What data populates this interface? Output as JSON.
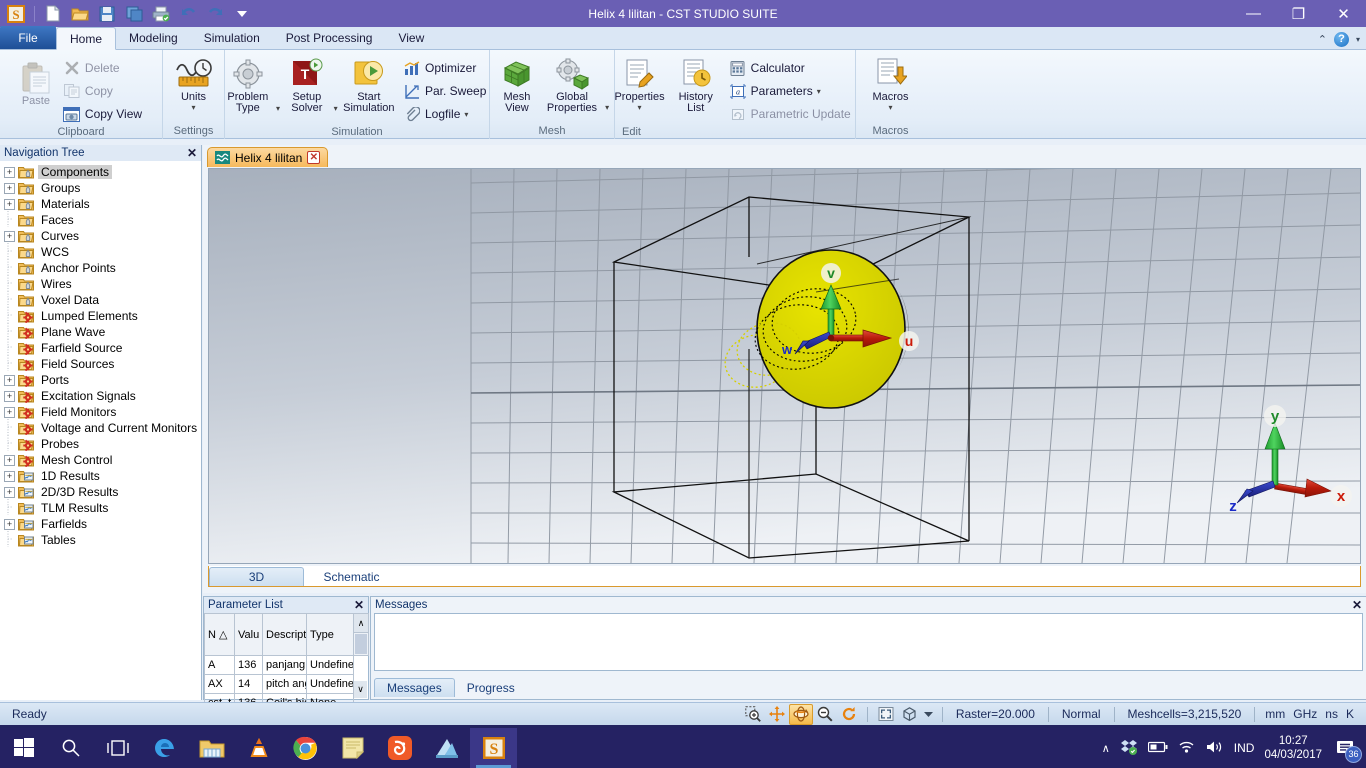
{
  "window": {
    "title": "Helix 4 lilitan - CST STUDIO SUITE",
    "minimize": "—",
    "restore": "❐",
    "close": "✕"
  },
  "quick_access": [
    {
      "name": "app-logo-icon",
      "glyph": "S"
    },
    {
      "name": "new-file-icon",
      "glyph": "📄"
    },
    {
      "name": "open-folder-icon",
      "glyph": "📂"
    },
    {
      "name": "save-icon",
      "glyph": "💾"
    },
    {
      "name": "save-as-icon",
      "glyph": "❐"
    },
    {
      "name": "print-icon",
      "glyph": "🖨"
    },
    {
      "name": "undo-icon",
      "glyph": "↶"
    },
    {
      "name": "redo-icon",
      "glyph": "↷"
    },
    {
      "name": "customize-qat-icon",
      "glyph": "▾"
    }
  ],
  "ribbon": {
    "file_tab": "File",
    "tabs": [
      {
        "label": "Home",
        "active": true
      },
      {
        "label": "Modeling",
        "active": false
      },
      {
        "label": "Simulation",
        "active": false
      },
      {
        "label": "Post Processing",
        "active": false
      },
      {
        "label": "View",
        "active": false
      }
    ],
    "minimize_ribbon": "⌃",
    "help": "?",
    "help_caret": "▾",
    "groups": [
      {
        "name": "clipboard",
        "label": "Clipboard",
        "big": [
          {
            "label": "Paste",
            "icon": "paste-icon",
            "disabled": true
          }
        ],
        "small": [
          {
            "label": "Delete",
            "icon": "delete-icon",
            "disabled": true
          },
          {
            "label": "Copy",
            "icon": "copy-icon",
            "disabled": true
          },
          {
            "label": "Copy View",
            "icon": "copy-view-icon",
            "disabled": false
          }
        ]
      },
      {
        "name": "settings",
        "label": "Settings",
        "big": [
          {
            "label": "Units",
            "icon": "units-icon",
            "caret": true
          }
        ],
        "small": []
      },
      {
        "name": "simulation",
        "label": "Simulation",
        "big": [
          {
            "label": "Problem Type",
            "icon": "problem-type-icon",
            "caret": true
          },
          {
            "label": "Setup Solver",
            "icon": "setup-solver-icon",
            "caret": true
          },
          {
            "label": "Start Simulation",
            "icon": "start-simulation-icon",
            "caret": false
          }
        ],
        "small": [
          {
            "label": "Optimizer",
            "icon": "optimizer-icon",
            "disabled": false
          },
          {
            "label": "Par. Sweep",
            "icon": "par-sweep-icon",
            "disabled": false
          },
          {
            "label": "Logfile",
            "icon": "logfile-icon",
            "disabled": false,
            "caret": true
          }
        ]
      },
      {
        "name": "mesh",
        "label": "Mesh",
        "big": [
          {
            "label": "Mesh View",
            "icon": "mesh-view-icon",
            "caret": false
          },
          {
            "label": "Global Properties",
            "icon": "global-properties-icon",
            "caret": true
          }
        ],
        "small": []
      },
      {
        "name": "edit",
        "label": "Edit",
        "big": [
          {
            "label": "Properties",
            "icon": "properties-icon",
            "caret": true
          },
          {
            "label": "History List",
            "icon": "history-list-icon",
            "caret": false
          }
        ],
        "small": [
          {
            "label": "Calculator",
            "icon": "calculator-icon",
            "disabled": false
          },
          {
            "label": "Parameters",
            "icon": "parameters-icon",
            "disabled": false,
            "caret": true
          },
          {
            "label": "Parametric Update",
            "icon": "parametric-update-icon",
            "disabled": true
          }
        ]
      },
      {
        "name": "macros",
        "label": "Macros",
        "big": [
          {
            "label": "Macros",
            "icon": "macros-icon",
            "caret": true
          }
        ],
        "small": []
      }
    ]
  },
  "navigation_tree": {
    "title": "Navigation Tree",
    "close": "✕",
    "items": [
      {
        "label": "Components",
        "expandable": true,
        "icon": "folder-shape-icon",
        "selected": true
      },
      {
        "label": "Groups",
        "expandable": true,
        "icon": "folder-shape-icon",
        "selected": false
      },
      {
        "label": "Materials",
        "expandable": true,
        "icon": "folder-shape-icon",
        "selected": false
      },
      {
        "label": "Faces",
        "expandable": false,
        "icon": "folder-shape-icon",
        "selected": false
      },
      {
        "label": "Curves",
        "expandable": true,
        "icon": "folder-shape-icon",
        "selected": false
      },
      {
        "label": "WCS",
        "expandable": false,
        "icon": "folder-shape-icon",
        "selected": false
      },
      {
        "label": "Anchor Points",
        "expandable": false,
        "icon": "folder-shape-icon",
        "selected": false
      },
      {
        "label": "Wires",
        "expandable": false,
        "icon": "folder-shape-icon",
        "selected": false
      },
      {
        "label": "Voxel Data",
        "expandable": false,
        "icon": "folder-shape-icon",
        "selected": false
      },
      {
        "label": "Lumped Elements",
        "expandable": false,
        "icon": "folder-gear-icon",
        "selected": false
      },
      {
        "label": "Plane Wave",
        "expandable": false,
        "icon": "folder-gear-icon",
        "selected": false
      },
      {
        "label": "Farfield Source",
        "expandable": false,
        "icon": "folder-gear-icon",
        "selected": false
      },
      {
        "label": "Field Sources",
        "expandable": false,
        "icon": "folder-gear-icon",
        "selected": false
      },
      {
        "label": "Ports",
        "expandable": true,
        "icon": "folder-gear-icon",
        "selected": false
      },
      {
        "label": "Excitation Signals",
        "expandable": true,
        "icon": "folder-gear-icon",
        "selected": false
      },
      {
        "label": "Field Monitors",
        "expandable": true,
        "icon": "folder-gear-icon",
        "selected": false
      },
      {
        "label": "Voltage and Current Monitors",
        "expandable": false,
        "icon": "folder-gear-icon",
        "selected": false
      },
      {
        "label": "Probes",
        "expandable": false,
        "icon": "folder-gear-icon",
        "selected": false
      },
      {
        "label": "Mesh Control",
        "expandable": true,
        "icon": "folder-gear-icon",
        "selected": false
      },
      {
        "label": "1D Results",
        "expandable": true,
        "icon": "folder-chart-icon",
        "selected": false
      },
      {
        "label": "2D/3D Results",
        "expandable": true,
        "icon": "folder-chart-icon",
        "selected": false
      },
      {
        "label": "TLM Results",
        "expandable": false,
        "icon": "folder-chart-icon",
        "selected": false
      },
      {
        "label": "Farfields",
        "expandable": true,
        "icon": "folder-chart-icon",
        "selected": false
      },
      {
        "label": "Tables",
        "expandable": false,
        "icon": "folder-chart-icon",
        "selected": false
      }
    ]
  },
  "document": {
    "tab_label": "Helix 4 lilitan",
    "tab_close": "✕",
    "view_tabs": [
      {
        "label": "3D",
        "active": true
      },
      {
        "label": "Schematic",
        "active": false
      }
    ],
    "axes_wcs": {
      "u": "u",
      "v": "v",
      "w": "w"
    },
    "axes_global": {
      "x": "x",
      "y": "y",
      "z": "z"
    }
  },
  "parameter_list": {
    "title": "Parameter List",
    "close": "✕",
    "columns": [
      "N △",
      "Valu",
      "Descript",
      "Type"
    ],
    "rows": [
      {
        "name": "A",
        "value": "136",
        "description": "panjang",
        "type": "Undefine"
      },
      {
        "name": "AX",
        "value": "14",
        "description": "pitch ang",
        "type": "Undefine"
      },
      {
        "name": "cst_t",
        "value": "136",
        "description": "Coil's hig",
        "type": "None"
      }
    ],
    "scroll_up": "∧",
    "scroll_down": "∨"
  },
  "messages": {
    "title": "Messages",
    "close": "✕",
    "body_text": "",
    "tabs": [
      {
        "label": "Messages",
        "active": true
      },
      {
        "label": "Progress",
        "active": false
      }
    ]
  },
  "status_bar": {
    "ready": "Ready",
    "tools": [
      {
        "name": "zoom-in-icon",
        "active": false
      },
      {
        "name": "pan-icon",
        "active": false
      },
      {
        "name": "rotate-icon",
        "active": true
      },
      {
        "name": "zoom-out-icon",
        "active": false
      },
      {
        "name": "reset-view-icon",
        "active": false
      }
    ],
    "view_tools": [
      {
        "name": "fit-to-screen-icon",
        "active": false
      },
      {
        "name": "bounding-box-icon",
        "active": false
      },
      {
        "name": "view-dropdown-caret-icon",
        "active": false
      }
    ],
    "raster": "Raster=20.000",
    "normal": "Normal",
    "meshcells": "Meshcells=3,215,520",
    "units": [
      "mm",
      "GHz",
      "ns",
      "K"
    ]
  },
  "taskbar": {
    "items": [
      {
        "name": "start-button-icon"
      },
      {
        "name": "search-icon"
      },
      {
        "name": "task-view-icon"
      },
      {
        "name": "edge-browser-icon"
      },
      {
        "name": "file-explorer-icon"
      },
      {
        "name": "vlc-player-icon"
      },
      {
        "name": "chrome-browser-icon"
      },
      {
        "name": "sticky-notes-icon"
      },
      {
        "name": "uc-browser-icon"
      },
      {
        "name": "photos-icon"
      },
      {
        "name": "cst-studio-icon"
      }
    ],
    "tray": {
      "show-hidden-icon": "∧",
      "dropbox-icon": "dropbox",
      "battery-icon": "battery",
      "wifi-icon": "wifi",
      "volume-icon": "volume",
      "language": "IND",
      "time": "10:27",
      "date": "04/03/2017",
      "notification_count": "36"
    }
  }
}
